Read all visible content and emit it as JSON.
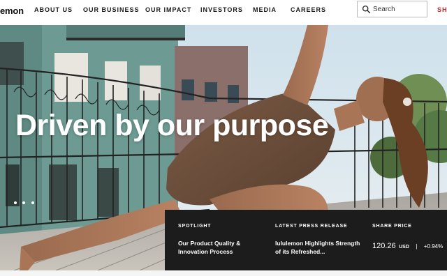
{
  "header": {
    "logo": "emon",
    "nav": [
      "ABOUT US",
      "OUR BUSINESS",
      "OUR IMPACT",
      "INVESTORS",
      "MEDIA",
      "CAREERS"
    ],
    "search_placeholder": "Search",
    "shop_label": "SHO"
  },
  "hero": {
    "headline": "Driven by our purpose",
    "carousel_dots": 3
  },
  "panel": {
    "spotlight_label": "SPOTLIGHT",
    "spotlight_line1": "Our Product Quality &",
    "spotlight_line2": "Innovation Process",
    "press_label": "LATEST PRESS RELEASE",
    "press_line1": "lululemon Highlights Strength",
    "press_line2": "of its Refreshed...",
    "share_label": "SHARE PRICE",
    "share_value": "120.26",
    "share_currency": "USD",
    "share_separator": "|",
    "share_change": "+0.94%"
  },
  "colors": {
    "brand_red": "#d31f26",
    "panel_bg": "#1c1c1c"
  }
}
